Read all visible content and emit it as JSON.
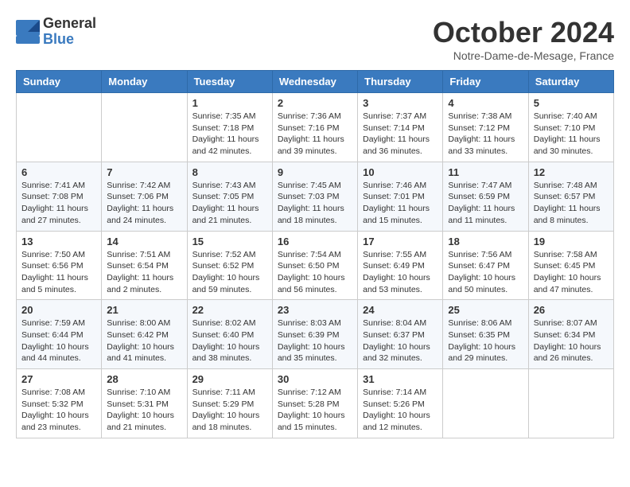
{
  "logo": {
    "general": "General",
    "blue": "Blue"
  },
  "header": {
    "month": "October 2024",
    "location": "Notre-Dame-de-Mesage, France"
  },
  "weekdays": [
    "Sunday",
    "Monday",
    "Tuesday",
    "Wednesday",
    "Thursday",
    "Friday",
    "Saturday"
  ],
  "weeks": [
    [
      {
        "day": "",
        "info": ""
      },
      {
        "day": "",
        "info": ""
      },
      {
        "day": "1",
        "info": "Sunrise: 7:35 AM\nSunset: 7:18 PM\nDaylight: 11 hours\nand 42 minutes."
      },
      {
        "day": "2",
        "info": "Sunrise: 7:36 AM\nSunset: 7:16 PM\nDaylight: 11 hours\nand 39 minutes."
      },
      {
        "day": "3",
        "info": "Sunrise: 7:37 AM\nSunset: 7:14 PM\nDaylight: 11 hours\nand 36 minutes."
      },
      {
        "day": "4",
        "info": "Sunrise: 7:38 AM\nSunset: 7:12 PM\nDaylight: 11 hours\nand 33 minutes."
      },
      {
        "day": "5",
        "info": "Sunrise: 7:40 AM\nSunset: 7:10 PM\nDaylight: 11 hours\nand 30 minutes."
      }
    ],
    [
      {
        "day": "6",
        "info": "Sunrise: 7:41 AM\nSunset: 7:08 PM\nDaylight: 11 hours\nand 27 minutes."
      },
      {
        "day": "7",
        "info": "Sunrise: 7:42 AM\nSunset: 7:06 PM\nDaylight: 11 hours\nand 24 minutes."
      },
      {
        "day": "8",
        "info": "Sunrise: 7:43 AM\nSunset: 7:05 PM\nDaylight: 11 hours\nand 21 minutes."
      },
      {
        "day": "9",
        "info": "Sunrise: 7:45 AM\nSunset: 7:03 PM\nDaylight: 11 hours\nand 18 minutes."
      },
      {
        "day": "10",
        "info": "Sunrise: 7:46 AM\nSunset: 7:01 PM\nDaylight: 11 hours\nand 15 minutes."
      },
      {
        "day": "11",
        "info": "Sunrise: 7:47 AM\nSunset: 6:59 PM\nDaylight: 11 hours\nand 11 minutes."
      },
      {
        "day": "12",
        "info": "Sunrise: 7:48 AM\nSunset: 6:57 PM\nDaylight: 11 hours\nand 8 minutes."
      }
    ],
    [
      {
        "day": "13",
        "info": "Sunrise: 7:50 AM\nSunset: 6:56 PM\nDaylight: 11 hours\nand 5 minutes."
      },
      {
        "day": "14",
        "info": "Sunrise: 7:51 AM\nSunset: 6:54 PM\nDaylight: 11 hours\nand 2 minutes."
      },
      {
        "day": "15",
        "info": "Sunrise: 7:52 AM\nSunset: 6:52 PM\nDaylight: 10 hours\nand 59 minutes."
      },
      {
        "day": "16",
        "info": "Sunrise: 7:54 AM\nSunset: 6:50 PM\nDaylight: 10 hours\nand 56 minutes."
      },
      {
        "day": "17",
        "info": "Sunrise: 7:55 AM\nSunset: 6:49 PM\nDaylight: 10 hours\nand 53 minutes."
      },
      {
        "day": "18",
        "info": "Sunrise: 7:56 AM\nSunset: 6:47 PM\nDaylight: 10 hours\nand 50 minutes."
      },
      {
        "day": "19",
        "info": "Sunrise: 7:58 AM\nSunset: 6:45 PM\nDaylight: 10 hours\nand 47 minutes."
      }
    ],
    [
      {
        "day": "20",
        "info": "Sunrise: 7:59 AM\nSunset: 6:44 PM\nDaylight: 10 hours\nand 44 minutes."
      },
      {
        "day": "21",
        "info": "Sunrise: 8:00 AM\nSunset: 6:42 PM\nDaylight: 10 hours\nand 41 minutes."
      },
      {
        "day": "22",
        "info": "Sunrise: 8:02 AM\nSunset: 6:40 PM\nDaylight: 10 hours\nand 38 minutes."
      },
      {
        "day": "23",
        "info": "Sunrise: 8:03 AM\nSunset: 6:39 PM\nDaylight: 10 hours\nand 35 minutes."
      },
      {
        "day": "24",
        "info": "Sunrise: 8:04 AM\nSunset: 6:37 PM\nDaylight: 10 hours\nand 32 minutes."
      },
      {
        "day": "25",
        "info": "Sunrise: 8:06 AM\nSunset: 6:35 PM\nDaylight: 10 hours\nand 29 minutes."
      },
      {
        "day": "26",
        "info": "Sunrise: 8:07 AM\nSunset: 6:34 PM\nDaylight: 10 hours\nand 26 minutes."
      }
    ],
    [
      {
        "day": "27",
        "info": "Sunrise: 7:08 AM\nSunset: 5:32 PM\nDaylight: 10 hours\nand 23 minutes."
      },
      {
        "day": "28",
        "info": "Sunrise: 7:10 AM\nSunset: 5:31 PM\nDaylight: 10 hours\nand 21 minutes."
      },
      {
        "day": "29",
        "info": "Sunrise: 7:11 AM\nSunset: 5:29 PM\nDaylight: 10 hours\nand 18 minutes."
      },
      {
        "day": "30",
        "info": "Sunrise: 7:12 AM\nSunset: 5:28 PM\nDaylight: 10 hours\nand 15 minutes."
      },
      {
        "day": "31",
        "info": "Sunrise: 7:14 AM\nSunset: 5:26 PM\nDaylight: 10 hours\nand 12 minutes."
      },
      {
        "day": "",
        "info": ""
      },
      {
        "day": "",
        "info": ""
      }
    ]
  ]
}
